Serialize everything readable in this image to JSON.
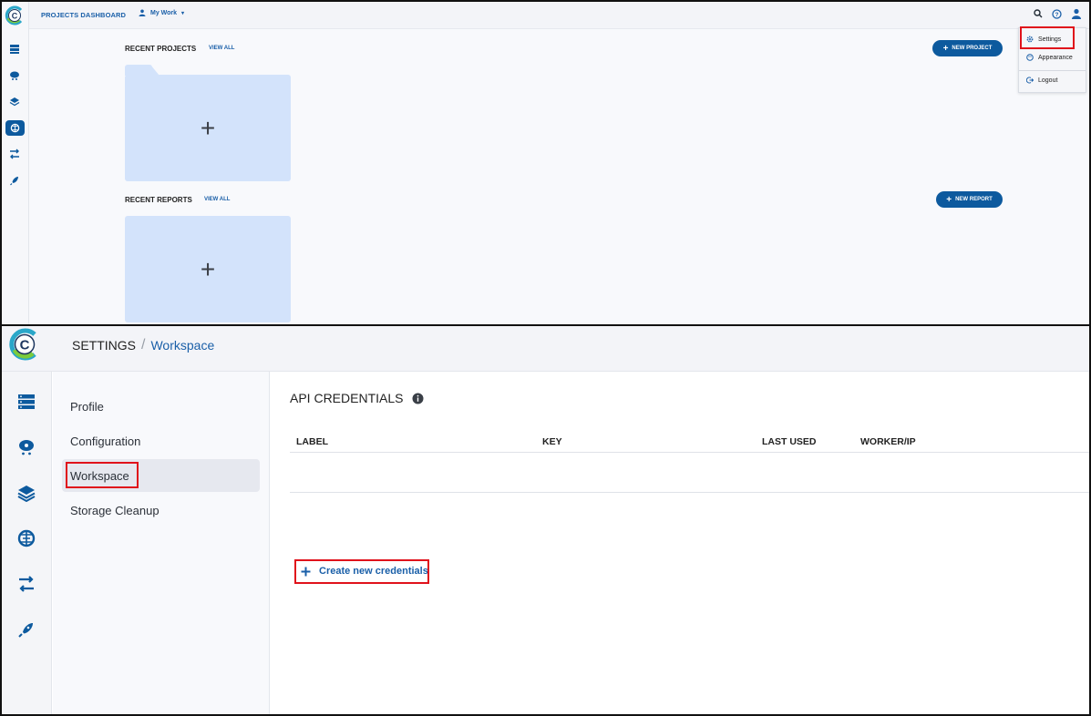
{
  "top": {
    "header": {
      "title": "PROJECTS DASHBOARD",
      "workspace_selector": "My Work"
    },
    "recent_projects": {
      "label": "RECENT PROJECTS",
      "view_all": "VIEW ALL",
      "new_button": "NEW PROJECT",
      "card_plus": "+"
    },
    "recent_reports": {
      "label": "RECENT REPORTS",
      "view_all": "VIEW ALL",
      "new_button": "NEW REPORT",
      "card_plus": "+"
    },
    "profile_menu": {
      "items": [
        "Settings",
        "Appearance",
        "Logout"
      ]
    },
    "icons": {
      "header": [
        "search-icon",
        "help-icon",
        "user-icon"
      ],
      "rail": [
        "projects-icon",
        "datasets-icon",
        "pipelines-icon",
        "models-icon",
        "orchestration-icon",
        "launch-icon"
      ]
    }
  },
  "bottom": {
    "breadcrumb": {
      "root": "SETTINGS",
      "separator": "/",
      "current": "Workspace"
    },
    "settings_menu": [
      "Profile",
      "Configuration",
      "Workspace",
      "Storage Cleanup"
    ],
    "selected_menu_item": "Workspace",
    "api_credentials": {
      "title": "API CREDENTIALS",
      "columns": [
        "LABEL",
        "KEY",
        "LAST USED",
        "WORKER/IP"
      ],
      "rows": [],
      "create_link": "Create new credentials"
    }
  },
  "colors": {
    "accent": "#0d5a9e",
    "card": "#d3e3fb",
    "highlight_box": "#e0121b"
  }
}
